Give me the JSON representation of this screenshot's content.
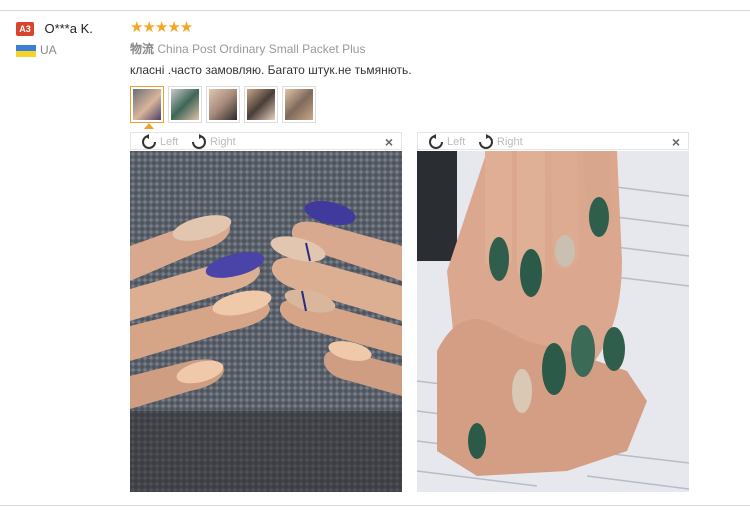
{
  "user": {
    "level_badge": "A3",
    "name": "O***a K.",
    "country": "UA"
  },
  "review": {
    "rating_stars": "★★★★★",
    "rating": 5,
    "shipping_cn": "物流",
    "shipping_method": "China Post Ordinary Small Packet Plus",
    "text": "класні .часто замовляю. Багато штук.не тьмянють."
  },
  "thumbnails": [
    {
      "icon": "nail-photo-thumbnail"
    },
    {
      "icon": "nail-photo-thumbnail"
    },
    {
      "icon": "nail-photo-thumbnail"
    },
    {
      "icon": "nail-photo-thumbnail"
    },
    {
      "icon": "nail-photo-thumbnail"
    }
  ],
  "viewer": {
    "rotate_left": "Left",
    "rotate_right": "Right",
    "close": "×"
  },
  "colors": {
    "star": "#f5a623",
    "badge": "#d9452c",
    "active_thumb": "#f0a030"
  }
}
